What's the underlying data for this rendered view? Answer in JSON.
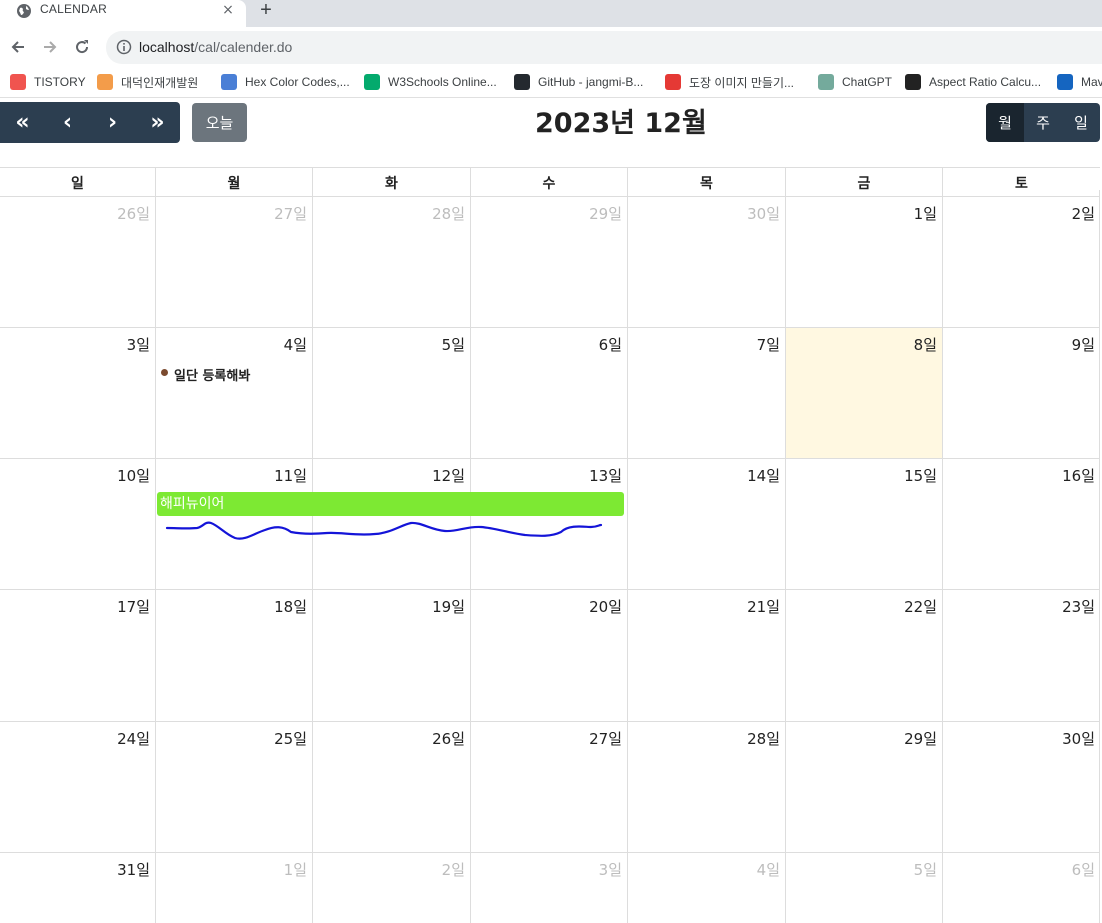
{
  "browser": {
    "tab_title": "CALENDAR",
    "tab_close": "×",
    "new_tab": "+",
    "url_host": "localhost",
    "url_path": "/cal/calender.do",
    "bookmarks": [
      {
        "label": "TISTORY",
        "color": "#f0544f"
      },
      {
        "label": "대덕인재개발원",
        "color": "#f39c4a"
      },
      {
        "label": "Hex Color Codes,...",
        "color": "#4a7fd6"
      },
      {
        "label": "W3Schools Online...",
        "color": "#04aa6d"
      },
      {
        "label": "GitHub - jangmi-B...",
        "color": "#24292f"
      },
      {
        "label": "도장 이미지 만들기...",
        "color": "#e53935"
      },
      {
        "label": "ChatGPT",
        "color": "#74aa9c"
      },
      {
        "label": "Aspect Ratio Calcu...",
        "color": "#222222"
      },
      {
        "label": "Mav",
        "color": "#1565c0"
      }
    ]
  },
  "calendar": {
    "nav": {
      "first": "«",
      "prev": "‹",
      "next": "›",
      "last": "»"
    },
    "today_label": "오늘",
    "title": "2023년 12월",
    "views": [
      "월",
      "주",
      "일"
    ],
    "active_view": "월",
    "weekdays": [
      "일",
      "월",
      "화",
      "수",
      "목",
      "금",
      "토"
    ],
    "weeks": [
      [
        {
          "d": "26일",
          "other": true
        },
        {
          "d": "27일",
          "other": true
        },
        {
          "d": "28일",
          "other": true
        },
        {
          "d": "29일",
          "other": true
        },
        {
          "d": "30일",
          "other": true
        },
        {
          "d": "1일"
        },
        {
          "d": "2일"
        }
      ],
      [
        {
          "d": "3일"
        },
        {
          "d": "4일"
        },
        {
          "d": "5일"
        },
        {
          "d": "6일"
        },
        {
          "d": "7일"
        },
        {
          "d": "8일",
          "today": true
        },
        {
          "d": "9일"
        }
      ],
      [
        {
          "d": "10일"
        },
        {
          "d": "11일"
        },
        {
          "d": "12일"
        },
        {
          "d": "13일"
        },
        {
          "d": "14일"
        },
        {
          "d": "15일"
        },
        {
          "d": "16일"
        }
      ],
      [
        {
          "d": "17일"
        },
        {
          "d": "18일"
        },
        {
          "d": "19일"
        },
        {
          "d": "20일"
        },
        {
          "d": "21일"
        },
        {
          "d": "22일"
        },
        {
          "d": "23일"
        }
      ],
      [
        {
          "d": "24일"
        },
        {
          "d": "25일"
        },
        {
          "d": "26일"
        },
        {
          "d": "27일"
        },
        {
          "d": "28일"
        },
        {
          "d": "29일"
        },
        {
          "d": "30일"
        }
      ],
      [
        {
          "d": "31일"
        },
        {
          "d": "1일",
          "other": true
        },
        {
          "d": "2일",
          "other": true
        },
        {
          "d": "3일",
          "other": true
        },
        {
          "d": "4일",
          "other": true
        },
        {
          "d": "5일",
          "other": true
        },
        {
          "d": "6일",
          "other": true
        }
      ]
    ],
    "events": {
      "dot_event": {
        "title": "일단 등록해봐",
        "color": "#7b4a2e"
      },
      "bar_event": {
        "title": "해피뉴이어",
        "color": "#7de933"
      }
    }
  }
}
